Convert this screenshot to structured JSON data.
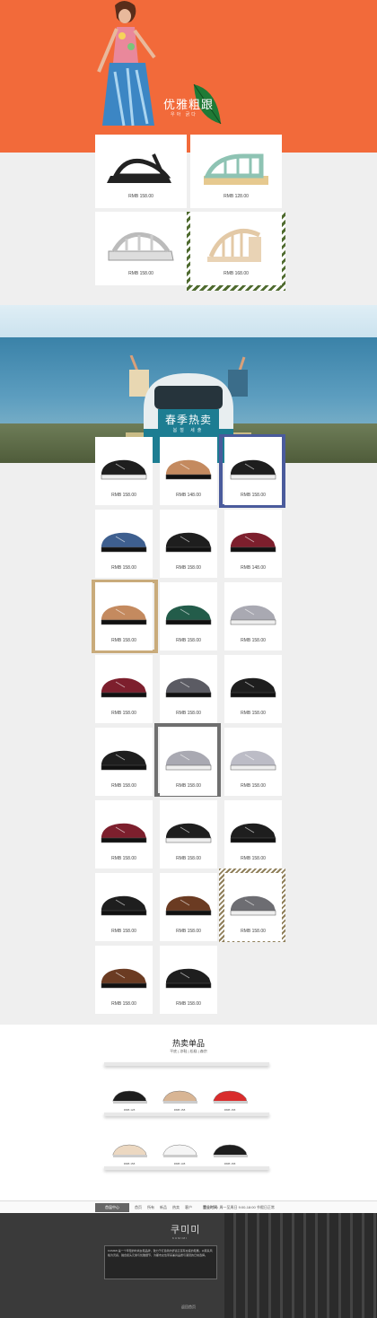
{
  "hero": {
    "title": "优雅粗跟",
    "subtitle": "우아 굵다",
    "colors": {
      "bg": "#f26a3a"
    }
  },
  "sandals": [
    {
      "icon": "black-platform-sandal-icon",
      "currency": "RMB",
      "price": "158",
      "suffix": ".00"
    },
    {
      "icon": "mint-wedge-sandal-icon",
      "currency": "RMB",
      "price": "128",
      "suffix": ".00"
    },
    {
      "icon": "white-platform-sandal-icon",
      "currency": "RMB",
      "price": "158",
      "suffix": ".00"
    },
    {
      "icon": "nude-block-heel-sandal-icon",
      "currency": "RMB",
      "price": "168",
      "suffix": ".00"
    }
  ],
  "band": {
    "title": "春季热卖",
    "subtitle": "봄철 세출"
  },
  "shoes": [
    {
      "icon": "black-silver-oxford-icon",
      "currency": "RMB",
      "price": "158",
      "suffix": ".00"
    },
    {
      "icon": "tan-loafer-icon",
      "currency": "RMB",
      "price": "148",
      "suffix": ".00"
    },
    {
      "icon": "black-patent-platform-icon",
      "currency": "RMB",
      "price": "158",
      "suffix": ".00"
    },
    {
      "icon": "blue-denim-oxford-icon",
      "currency": "RMB",
      "price": "158",
      "suffix": ".00"
    },
    {
      "icon": "black-studded-oxford-icon",
      "currency": "RMB",
      "price": "158",
      "suffix": ".00"
    },
    {
      "icon": "burgundy-patent-oxford-icon",
      "currency": "RMB",
      "price": "148",
      "suffix": ".00"
    },
    {
      "icon": "tan-strap-loafer-icon",
      "currency": "RMB",
      "price": "158",
      "suffix": ".00"
    },
    {
      "icon": "green-strap-oxford-icon",
      "currency": "RMB",
      "price": "158",
      "suffix": ".00"
    },
    {
      "icon": "silver-lace-oxford-icon",
      "currency": "RMB",
      "price": "158",
      "suffix": ".00"
    },
    {
      "icon": "burgundy-tassel-loafer-icon",
      "currency": "RMB",
      "price": "158",
      "suffix": ".00"
    },
    {
      "icon": "gunmetal-oxford-icon",
      "currency": "RMB",
      "price": "158",
      "suffix": ".00"
    },
    {
      "icon": "black-patent-lace-icon",
      "currency": "RMB",
      "price": "158",
      "suffix": ".00"
    },
    {
      "icon": "black-patent-derby-icon",
      "currency": "RMB",
      "price": "158",
      "suffix": ".00"
    },
    {
      "icon": "silver-platform-oxford-icon",
      "currency": "RMB",
      "price": "158",
      "suffix": ".00"
    },
    {
      "icon": "metallic-platform-oxford-icon",
      "currency": "RMB",
      "price": "158",
      "suffix": ".00"
    },
    {
      "icon": "burgundy-brogue-icon",
      "currency": "RMB",
      "price": "158",
      "suffix": ".00"
    },
    {
      "icon": "black-white-platform-icon",
      "currency": "RMB",
      "price": "158",
      "suffix": ".00"
    },
    {
      "icon": "black-pointed-oxford-icon",
      "currency": "RMB",
      "price": "158",
      "suffix": ".00"
    },
    {
      "icon": "black-ankle-boot-icon",
      "currency": "RMB",
      "price": "158",
      "suffix": ".00"
    },
    {
      "icon": "brown-zip-bootie-icon",
      "currency": "RMB",
      "price": "158",
      "suffix": ".00"
    },
    {
      "icon": "gray-platform-oxford-icon",
      "currency": "RMB",
      "price": "158",
      "suffix": ".00"
    },
    {
      "icon": "brown-lace-brogue-icon",
      "currency": "RMB",
      "price": "158",
      "suffix": ".00"
    },
    {
      "icon": "black-heel-bootie-icon",
      "currency": "RMB",
      "price": "158",
      "suffix": ".00"
    }
  ],
  "hot": {
    "title": "热卖单品",
    "subtitle": "平底 | 凉鞋 | 松糕 | 森宗",
    "items": [
      {
        "icon": "black-cutout-sandal-icon",
        "price": "RMB 128"
      },
      {
        "icon": "beige-block-sandal-icon",
        "price": "RMB 158"
      },
      {
        "icon": "red-cutout-flat-icon",
        "price": "RMB 158"
      },
      {
        "icon": "nude-ankle-strap-icon",
        "price": "RMB 158"
      },
      {
        "icon": "white-flatform-sandal-icon",
        "price": "RMB 138"
      },
      {
        "icon": "black-strap-sandal-icon",
        "price": "RMB 158"
      }
    ]
  },
  "nav": {
    "home": "首届中心",
    "links": [
      "首页",
      "所有",
      "新品",
      "热卖",
      "客户"
    ],
    "hours_label": "营业时间:",
    "hours_value": "周一至周日 9:00-18:00 节假日正常"
  },
  "footer": {
    "brand": "쿠미미",
    "brand_sub": "KUMIMI",
    "about": "KUMIMI 是一个年轻的时尚女鞋品牌，致力于打造简约舒适又富有态度的鞋履。以韩系风格为灵感，融合街头元素与优雅细节，为都市女性带来兼具品质与潮流的日常选择。",
    "bottom": "返回首页"
  }
}
